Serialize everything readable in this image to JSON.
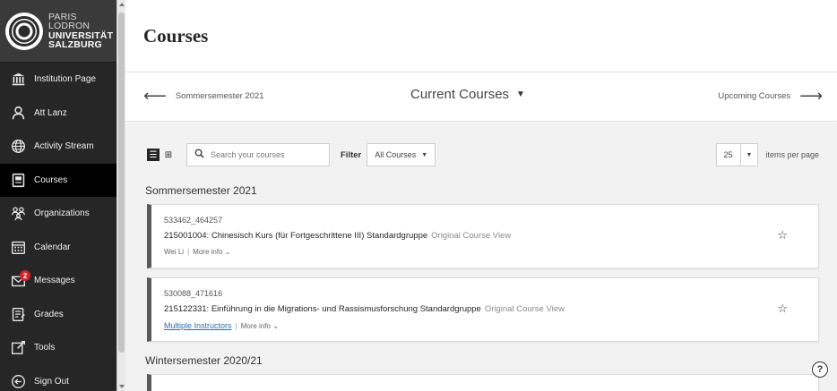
{
  "logo": {
    "lines": [
      "PARIS",
      "LODRON",
      "UNIVERSITÄT",
      "SALZBURG"
    ]
  },
  "sidebar": {
    "items": [
      {
        "label": "Institution Page",
        "icon": "institution-icon"
      },
      {
        "label": "Att Lanz",
        "icon": "user-icon"
      },
      {
        "label": "Activity Stream",
        "icon": "globe-icon"
      },
      {
        "label": "Courses",
        "icon": "courses-icon",
        "active": true
      },
      {
        "label": "Organizations",
        "icon": "organizations-icon"
      },
      {
        "label": "Calendar",
        "icon": "calendar-icon"
      },
      {
        "label": "Messages",
        "icon": "messages-icon",
        "badge": "2"
      },
      {
        "label": "Grades",
        "icon": "grades-icon"
      },
      {
        "label": "Tools",
        "icon": "tools-icon"
      },
      {
        "label": "Sign Out",
        "icon": "sign-out-icon"
      }
    ]
  },
  "page": {
    "title": "Courses"
  },
  "termbar": {
    "prev_label": "Sommersemester 2021",
    "current_label": "Current Courses",
    "next_label": "Upcoming Courses"
  },
  "toolbar": {
    "search_placeholder": "Search your courses",
    "filter_label": "Filter",
    "filter_value": "All Courses",
    "page_size": "25",
    "items_per_page_label": "items per page"
  },
  "terms": [
    {
      "heading": "Sommersemester 2021",
      "courses": [
        {
          "id": "533462_464257",
          "title": "215001004: Chinesisch Kurs (für Fortgeschrittene III) Standardgruppe",
          "view": "Original Course View",
          "instructor": "Wei Li",
          "more": "More info"
        },
        {
          "id": "530088_471616",
          "title": "215122331: Einführung in die Migrations- und Rassismusforschung Standardgruppe",
          "view": "Original Course View",
          "instructor": "Multiple Instructors",
          "more": "More info"
        }
      ]
    },
    {
      "heading": "Wintersemester 2020/21"
    }
  ],
  "colors": {
    "sidebar_bg": "#262626",
    "sidebar_active": "#000000",
    "badge": "#d2232a",
    "link": "#2a6fb0",
    "content_bg": "#f2f2f2"
  }
}
